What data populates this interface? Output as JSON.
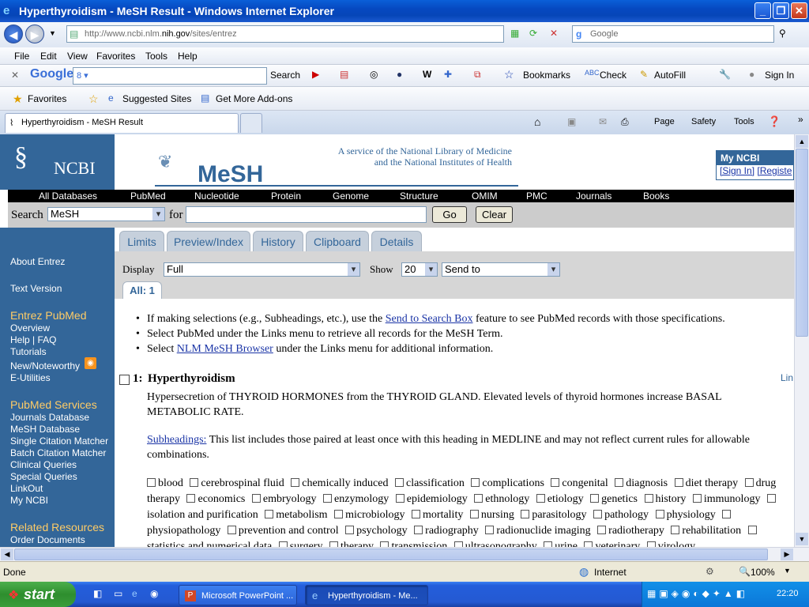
{
  "window": {
    "title": "Hyperthyroidism - MeSH Result - Windows Internet Explorer"
  },
  "address": {
    "url_prefix": "http://www.ncbi.nlm.",
    "url_domain": "nih.gov",
    "url_suffix": "/sites/entrez",
    "search_placeholder": "Google"
  },
  "menu": [
    "File",
    "Edit",
    "View",
    "Favorites",
    "Tools",
    "Help"
  ],
  "google_toolbar": {
    "search_label": "Search",
    "bookmarks": "Bookmarks",
    "check": "Check",
    "autofill": "AutoFill",
    "sign_in": "Sign In"
  },
  "favorites_bar": {
    "favorites": "Favorites",
    "suggested": "Suggested Sites",
    "addons": "Get More Add-ons"
  },
  "tab": {
    "title": "Hyperthyroidism - MeSH Result"
  },
  "command_bar": {
    "page": "Page",
    "safety": "Safety",
    "tools": "Tools"
  },
  "ncbi": {
    "logo_text": "NCBI",
    "mesh_logo": "MeSH",
    "service_line1": "A service of the National Library of Medicine",
    "service_line2": "and the National Institutes of Health",
    "my_ncbi": "My NCBI",
    "sign_in": "[Sign In]",
    "register": "[Registe",
    "db_nav": [
      "All Databases",
      "PubMed",
      "Nucleotide",
      "Protein",
      "Genome",
      "Structure",
      "OMIM",
      "PMC",
      "Journals",
      "Books"
    ],
    "search_label": "Search",
    "search_db": "MeSH",
    "for_label": "for",
    "go": "Go",
    "clear": "Clear",
    "tabs": [
      "Limits",
      "Preview/Index",
      "History",
      "Clipboard",
      "Details"
    ],
    "display_label": "Display",
    "display_value": "Full",
    "show_label": "Show",
    "show_value": "20",
    "send_to": "Send to",
    "all_tab": "All: 1"
  },
  "leftnav": {
    "about": "About Entrez",
    "text_version": "Text Version",
    "entrez_pubmed": "Entrez PubMed",
    "overview": "Overview",
    "help": "Help | FAQ",
    "tutorials": "Tutorials",
    "new": "New/Noteworthy",
    "eutilities": "E-Utilities",
    "services": "PubMed Services",
    "journals_db": "Journals Database",
    "mesh_db": "MeSH Database",
    "single": "Single Citation Matcher",
    "batch": "Batch Citation Matcher",
    "clinical": "Clinical Queries",
    "special": "Special Queries",
    "linkout": "LinkOut",
    "myncbi": "My NCBI",
    "related": "Related Resources",
    "order": "Order Documents"
  },
  "info": {
    "b1_pre": "If making selections (e.g., Subheadings, etc.), use the ",
    "b1_link": "Send to Search Box",
    "b1_post": " feature to see PubMed records with those specifications.",
    "b2": "Select PubMed under the Links menu to retrieve all records for the MeSH Term.",
    "b3_pre": "Select ",
    "b3_link": "NLM MeSH Browser",
    "b3_post": " under the Links menu for additional information."
  },
  "record": {
    "number": "1:",
    "title": "Hyperthyroidism",
    "links": "Lin",
    "definition": "Hypersecretion of THYROID HORMONES from the THYROID GLAND. Elevated levels of thyroid hormones increase BASAL METABOLIC RATE.",
    "sub_link": "Subheadings:",
    "sub_text": " This list includes those paired at least once with this heading in MEDLINE and may not reflect current rules for allowable combinations.",
    "subheadings": [
      "blood",
      "cerebrospinal fluid",
      "chemically induced",
      "classification",
      "complications",
      "congenital",
      "diagnosis",
      "diet therapy",
      "drug therapy",
      "economics",
      "embryology",
      "enzymology",
      "epidemiology",
      "ethnology",
      "etiology",
      "genetics",
      "history",
      "immunology",
      "isolation and purification",
      "metabolism",
      "microbiology",
      "mortality",
      "nursing",
      "parasitology",
      "pathology",
      "physiology",
      "physiopathology",
      "prevention and control",
      "psychology",
      "radiography",
      "radionuclide imaging",
      "radiotherapy",
      "rehabilitation",
      "statistics and numerical data",
      "surgery",
      "therapy",
      "transmission",
      "ultrasonography",
      "urine",
      "veterinary",
      "virology"
    ]
  },
  "status": {
    "text": "Done",
    "zone": "Internet",
    "zoom": "100%"
  },
  "taskbar": {
    "start": "start",
    "task1": "Microsoft PowerPoint ...",
    "task2": "Hyperthyroidism - Me...",
    "clock": "22:20"
  }
}
